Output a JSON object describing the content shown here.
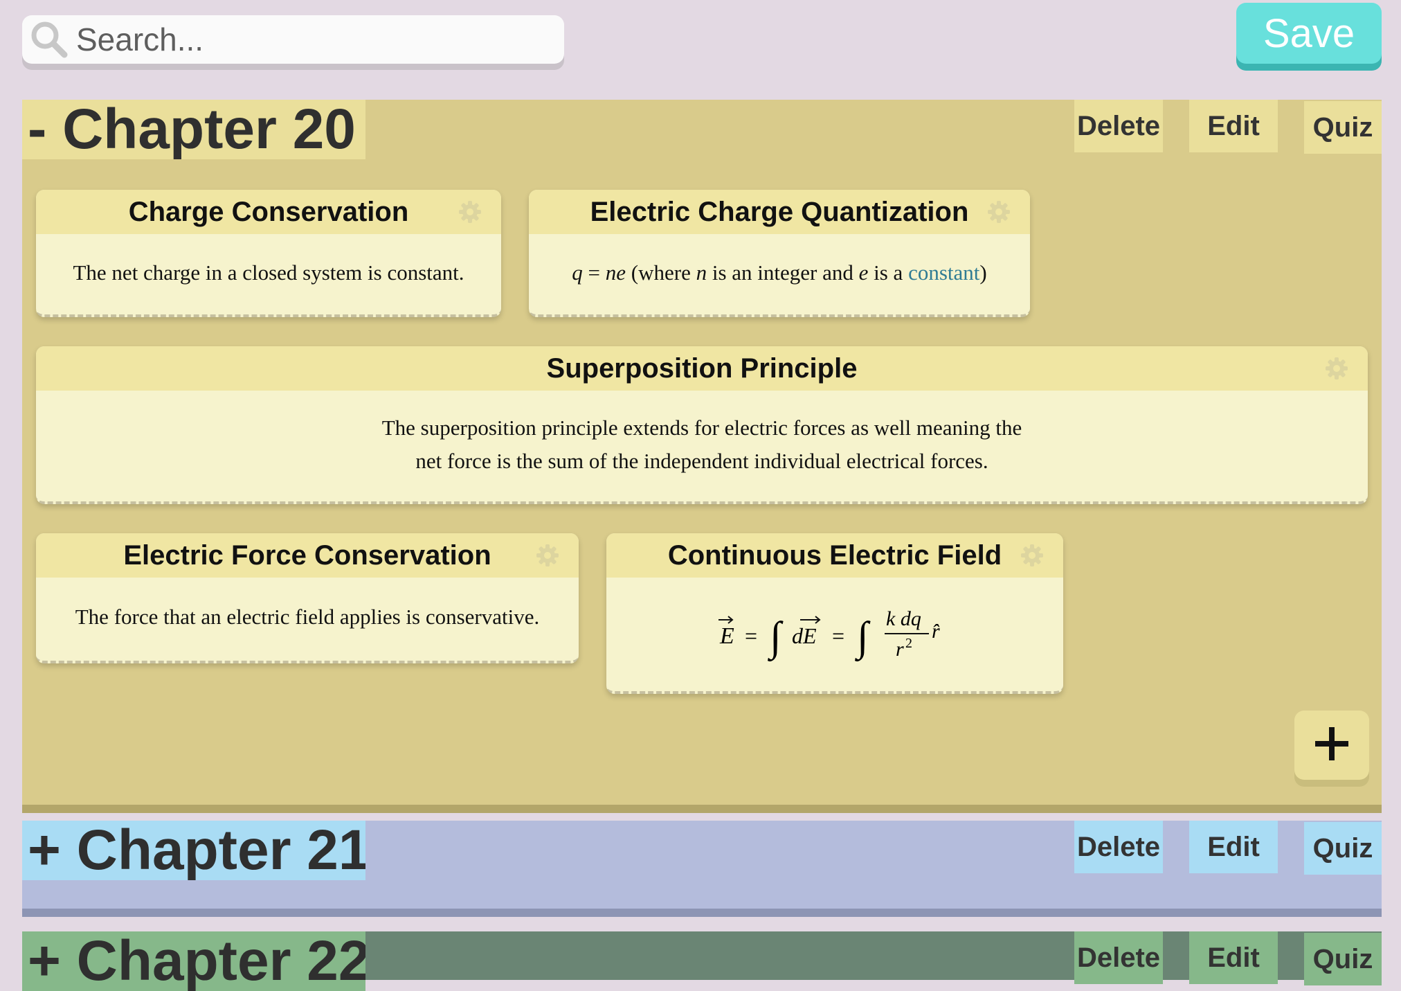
{
  "search": {
    "placeholder": "Search..."
  },
  "toolbar": {
    "save_label": "Save"
  },
  "chapter_actions": {
    "delete": "Delete",
    "edit": "Edit",
    "quiz": "Quiz"
  },
  "chapters": [
    {
      "title": "- Chapter 20",
      "expanded": true,
      "color": "#d9cb8b",
      "header_color": "#eadf9b"
    },
    {
      "title": "+ Chapter 21",
      "expanded": false,
      "color": "#b4bcdc",
      "header_color": "#a9dcf4"
    },
    {
      "title": "+ Chapter 22",
      "expanded": false,
      "color": "#6a8574",
      "header_color": "#86b88a"
    }
  ],
  "cards": {
    "charge_conservation": {
      "title": "Charge Conservation",
      "body": "The net charge in a closed system is constant."
    },
    "quantization": {
      "title": "Electric Charge Quantization",
      "body_parts": [
        "q",
        " = ",
        "ne",
        " (where ",
        "n",
        " is an integer and ",
        "e",
        " is a ",
        "constant",
        ")"
      ]
    },
    "superposition": {
      "title": "Superposition Principle",
      "body": "The superposition principle extends for electric forces as well meaning the net force is the sum of the independent individual electrical forces."
    },
    "force_conservation": {
      "title": "Electric Force Conservation",
      "body": "The force that an electric field applies is conservative."
    },
    "continuous_field": {
      "title": "Continuous Electric Field",
      "formula": {
        "E": "E",
        "dE": "dE",
        "eq": "=",
        "integral": "∫",
        "num": "k dq",
        "den": "r",
        "exp": "2",
        "rhat": "r̂"
      }
    }
  },
  "add_button": {
    "label": "+"
  },
  "colors": {
    "accent": "#68e0dc",
    "link": "#2f7b94",
    "card": "#f6f3cd"
  },
  "icons": [
    "search-icon",
    "gear-icon",
    "plus-icon"
  ]
}
